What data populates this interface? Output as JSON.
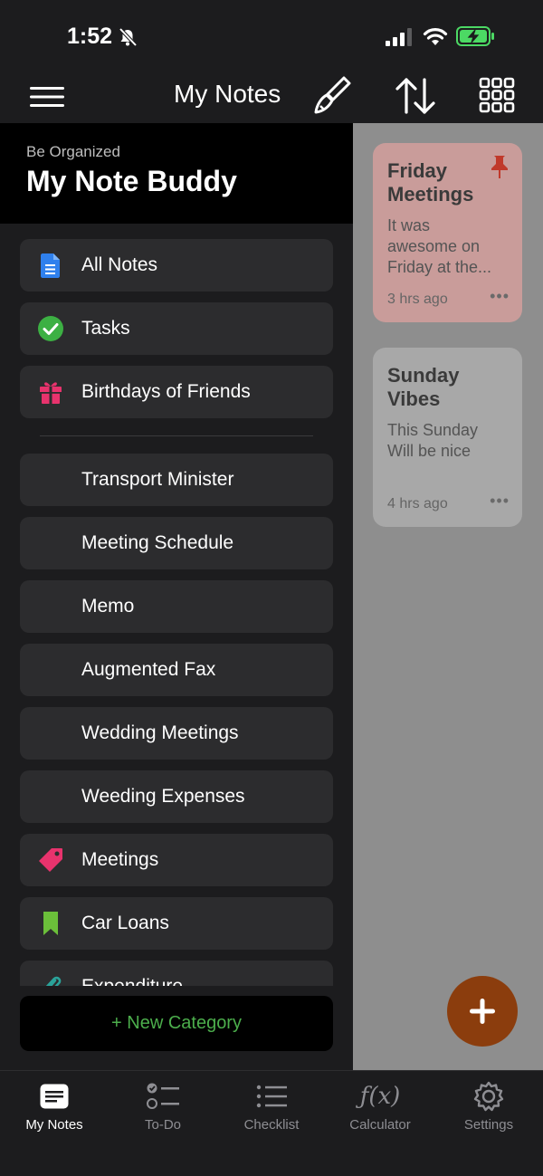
{
  "status_bar": {
    "time": "1:52"
  },
  "header": {
    "title": "My Notes"
  },
  "drawer": {
    "subtitle": "Be Organized",
    "title": "My Note Buddy",
    "items": [
      {
        "label": "All Notes",
        "icon": "document-icon",
        "color": "#2f80ed"
      },
      {
        "label": "Tasks",
        "icon": "check-circle-icon",
        "color": "#3cb043"
      },
      {
        "label": "Birthdays of Friends",
        "icon": "gift-icon",
        "color": "#e8336d"
      },
      {
        "label": "Transport Minister"
      },
      {
        "label": "Meeting Schedule"
      },
      {
        "label": "Memo"
      },
      {
        "label": "Augmented Fax"
      },
      {
        "label": "Wedding Meetings"
      },
      {
        "label": "Weeding Expenses"
      },
      {
        "label": "Meetings",
        "icon": "tag-icon",
        "color": "#e8336d"
      },
      {
        "label": "Car Loans",
        "icon": "bookmark-icon",
        "color": "#6bbf3a"
      },
      {
        "label": "Expenditure",
        "icon": "paperclip-icon",
        "color": "#2aa39a"
      }
    ],
    "new_category": "+ New Category"
  },
  "notes": [
    {
      "title": "Friday\nMeetings",
      "body": "It was\nawesome on\nFriday at the...",
      "time": "3 hrs ago",
      "pinned": true,
      "color": "#c99c9a"
    },
    {
      "title": "Sunday\nVibes",
      "body": "This Sunday\nWill be nice",
      "time": "4 hrs ago",
      "pinned": false,
      "color": "#a8a8a8"
    }
  ],
  "tabs": [
    {
      "label": "My Notes",
      "icon": "notes-icon",
      "active": true
    },
    {
      "label": "To-Do",
      "icon": "todo-icon",
      "active": false
    },
    {
      "label": "Checklist",
      "icon": "checklist-icon",
      "active": false
    },
    {
      "label": "Calculator",
      "icon": "function-icon",
      "active": false,
      "glyph": "ƒ(x)"
    },
    {
      "label": "Settings",
      "icon": "gear-icon",
      "active": false
    }
  ]
}
